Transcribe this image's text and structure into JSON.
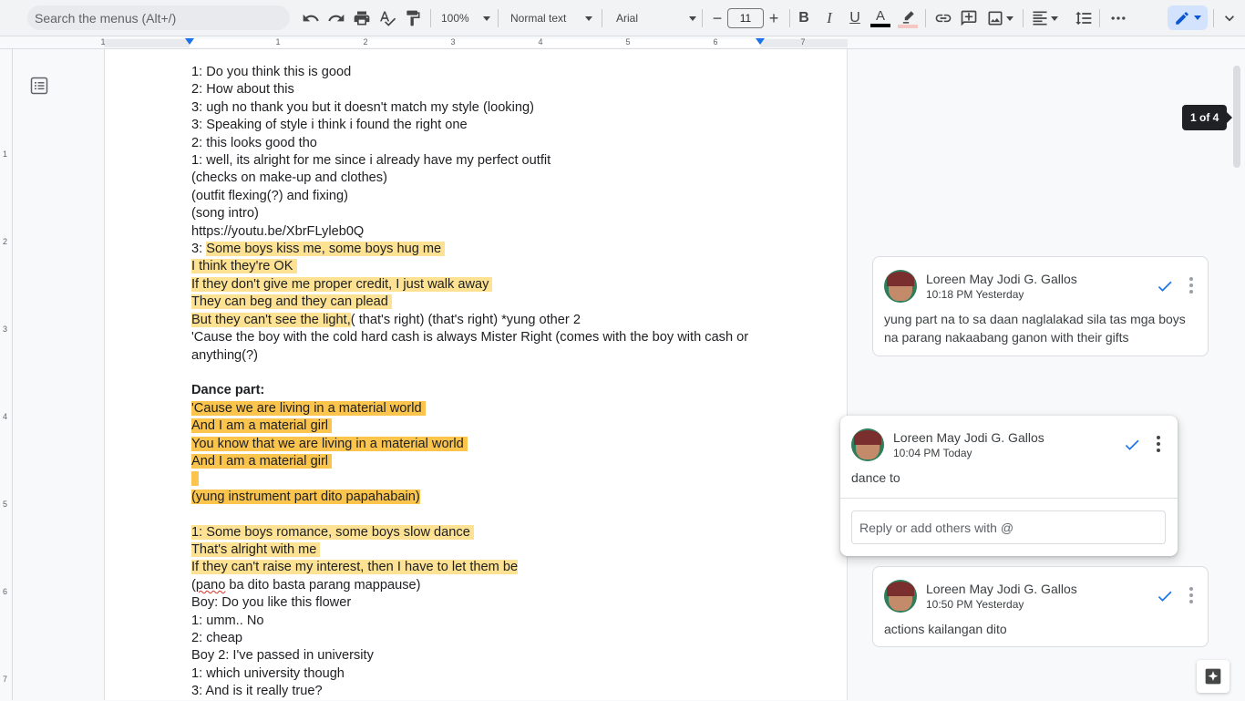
{
  "toolbar": {
    "search_placeholder": "Search the menus (Alt+/)",
    "zoom": "100%",
    "style": "Normal text",
    "font": "Arial",
    "font_size": "11"
  },
  "ruler": {
    "numbers": [
      "1",
      "1",
      "2",
      "3",
      "4",
      "5",
      "6",
      "7"
    ],
    "vertical_numbers": [
      "1",
      "2",
      "3",
      "4",
      "5",
      "6",
      "7"
    ]
  },
  "document": {
    "lines": [
      {
        "text": "1: Do you think this is good"
      },
      {
        "text": "2: How about this"
      },
      {
        "text": "3: ugh no thank you but it doesn't match my style (looking)"
      },
      {
        "text": "3: Speaking of style i think i found the right one"
      },
      {
        "text": "2: this looks good tho"
      },
      {
        "text": "1: well, its alright for me since i already have my perfect outfit"
      },
      {
        "text": "(checks on make-up and clothes)"
      },
      {
        "text": "(outfit flexing(?) and fixing)"
      },
      {
        "text": "(song intro)"
      },
      {
        "text": "https://youtu.be/XbrFLyleb0Q"
      },
      {
        "prefix": "3: ",
        "highlight": "Some boys kiss me, some boys hug me "
      },
      {
        "highlight": "I think they're OK "
      },
      {
        "highlight": "If they don't give me proper credit, I just walk away "
      },
      {
        "highlight": "They can beg and they can plead "
      },
      {
        "highlight": "But they can't see the light,",
        "suffix": "( that's right) (that's right) *yung other 2"
      },
      {
        "text": "'Cause the boy with the cold hard cash is always Mister Right (comes with the boy with cash or anything(?)",
        "wrap": true
      },
      {
        "text": ""
      },
      {
        "bold": "Dance part:"
      },
      {
        "strong": "'Cause we are living in a material world "
      },
      {
        "strong": "And I am a material girl "
      },
      {
        "strong": "You know that we are living in a material world "
      },
      {
        "strong": "And I am a material girl "
      },
      {
        "strong": "  "
      },
      {
        "strong": "(yung instrument part dito papahabain)"
      },
      {
        "text": ""
      },
      {
        "highlight": "1: Some boys romance, some boys slow dance "
      },
      {
        "highlight": "That's alright with me "
      },
      {
        "highlight": "If they can't raise my interest, then I have to let them be"
      },
      {
        "squiggle": "pano",
        "text": "(",
        "after": " ba dito basta parang mappause)"
      },
      {
        "text": "Boy: Do you like this flower"
      },
      {
        "text": "1: umm.. No"
      },
      {
        "text": "2: cheap"
      },
      {
        "text": "Boy 2: I've passed in university"
      },
      {
        "text": "1: which university though"
      },
      {
        "text": "3: And is it really true?"
      }
    ]
  },
  "comments": [
    {
      "author": "Loreen May Jodi G. Gallos",
      "time": "10:18 PM Yesterday",
      "body": "yung part na to sa daan naglalakad sila tas mga boys na parang nakaabang ganon with their gifts"
    },
    {
      "author": "Loreen May Jodi G. Gallos",
      "time": "10:04 PM Today",
      "body": "dance to",
      "reply_placeholder": "Reply or add others with @"
    },
    {
      "author": "Loreen May Jodi G. Gallos",
      "time": "10:50 PM Yesterday",
      "body": "actions kailangan dito"
    }
  ],
  "pager": "1 of 4",
  "colors": {
    "accent": "#1a73e8",
    "highlight_light": "#fde293",
    "highlight_strong": "#fbc44d"
  }
}
